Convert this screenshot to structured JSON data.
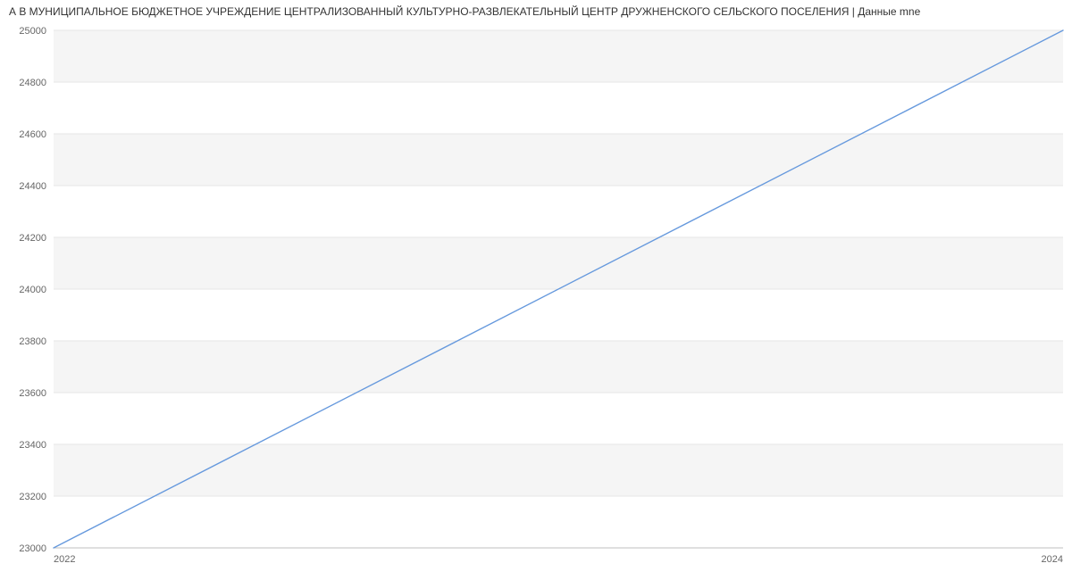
{
  "title": "А В МУНИЦИПАЛЬНОЕ БЮДЖЕТНОЕ УЧРЕЖДЕНИЕ ЦЕНТРАЛИЗОВАННЫЙ КУЛЬТУРНО-РАЗВЛЕКАТЕЛЬНЫЙ ЦЕНТР ДРУЖНЕНСКОГО СЕЛЬСКОГО ПОСЕЛЕНИЯ | Данные mne",
  "chart_data": {
    "type": "line",
    "x": [
      2022,
      2024
    ],
    "series": [
      {
        "name": "series1",
        "values": [
          23000,
          25000
        ]
      }
    ],
    "title": "",
    "xlabel": "",
    "ylabel": "",
    "xlim": [
      2022,
      2024
    ],
    "ylim": [
      23000,
      25000
    ],
    "xticks": [
      2022,
      2024
    ],
    "yticks": [
      23000,
      23200,
      23400,
      23600,
      23800,
      24000,
      24200,
      24400,
      24600,
      24800,
      25000
    ],
    "grid": true
  }
}
